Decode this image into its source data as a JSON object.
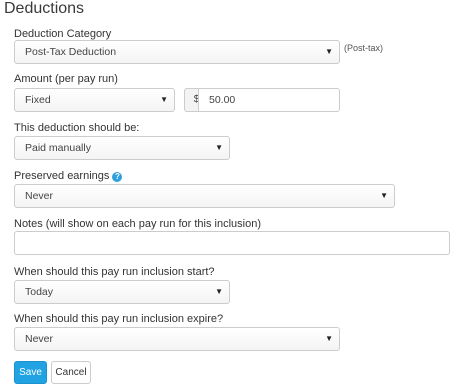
{
  "section_title": "Deductions",
  "deduction_category": {
    "label": "Deduction Category",
    "value": "Post-Tax Deduction",
    "hint": "(Post-tax)"
  },
  "amount": {
    "label": "Amount (per pay run)",
    "type_value": "Fixed",
    "currency_symbol": "$",
    "value": "50.00"
  },
  "paid_method": {
    "label": "This deduction should be:",
    "value": "Paid manually"
  },
  "preserved_earnings": {
    "label": "Preserved earnings",
    "help_icon": "?",
    "value": "Never"
  },
  "notes": {
    "label": "Notes (will show on each pay run for this inclusion)",
    "value": ""
  },
  "start": {
    "label": "When should this pay run inclusion start?",
    "value": "Today"
  },
  "expire": {
    "label": "When should this pay run inclusion expire?",
    "value": "Never"
  },
  "caret": "▼",
  "buttons": {
    "save": "Save",
    "cancel": "Cancel"
  },
  "colors": {
    "primary": "#21a3e3",
    "help_icon": "#2f9fdb"
  }
}
